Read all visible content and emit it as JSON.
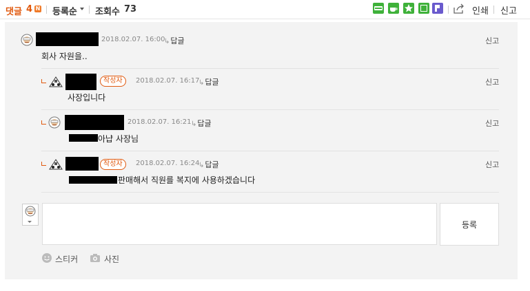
{
  "header": {
    "comment_label": "댓글",
    "comment_count": "4",
    "new_badge": "N",
    "sort_label": "등록순",
    "views_label": "조회수",
    "views_count": "73",
    "print_label": "인쇄",
    "report_label": "신고"
  },
  "share_icons": [
    {
      "name": "blog-share-icon",
      "color": "#3fb13a"
    },
    {
      "name": "cafe-share-icon",
      "color": "#3fb13a"
    },
    {
      "name": "bookmark-star-icon",
      "color": "#3fb13a"
    },
    {
      "name": "memo-share-icon",
      "color": "#3fb13a"
    },
    {
      "name": "band-share-icon",
      "color": "#6a5acd"
    }
  ],
  "comments": [
    {
      "author_hidden": true,
      "date": "2018.02.07. 16:00",
      "reply_label": "답글",
      "report_label": "신고",
      "text": "회사 자원을.."
    },
    {
      "author_hidden": true,
      "author_badge": "작성자",
      "date": "2018.02.07. 16:17",
      "reply_label": "답글",
      "report_label": "신고",
      "text": "사장입니다"
    },
    {
      "author_hidden": true,
      "date": "2018.02.07. 16:21",
      "reply_label": "답글",
      "report_label": "신고",
      "text": "아냡 사장님"
    },
    {
      "author_hidden": true,
      "author_badge": "작성자",
      "date": "2018.02.07. 16:24",
      "reply_label": "답글",
      "report_label": "신고",
      "text": "판매해서 직원를 복지에 사용하겠습니다"
    }
  ],
  "composer": {
    "placeholder": "",
    "submit_label": "등록",
    "sticker_label": "스티커",
    "photo_label": "사진"
  },
  "colors": {
    "accent": "#e0590e",
    "panel_bg": "#f3f3f3"
  }
}
